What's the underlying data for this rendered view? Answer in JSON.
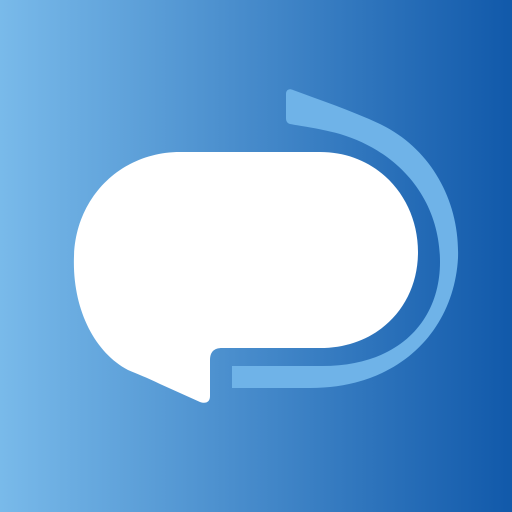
{
  "app_icon": {
    "icon": "chat-bubble-refresh-icon",
    "colors": {
      "gradient_start": "#79BAEA",
      "gradient_end": "#1159AA",
      "arc": "#6FB3E8",
      "bubble": "#FFFFFF"
    }
  }
}
